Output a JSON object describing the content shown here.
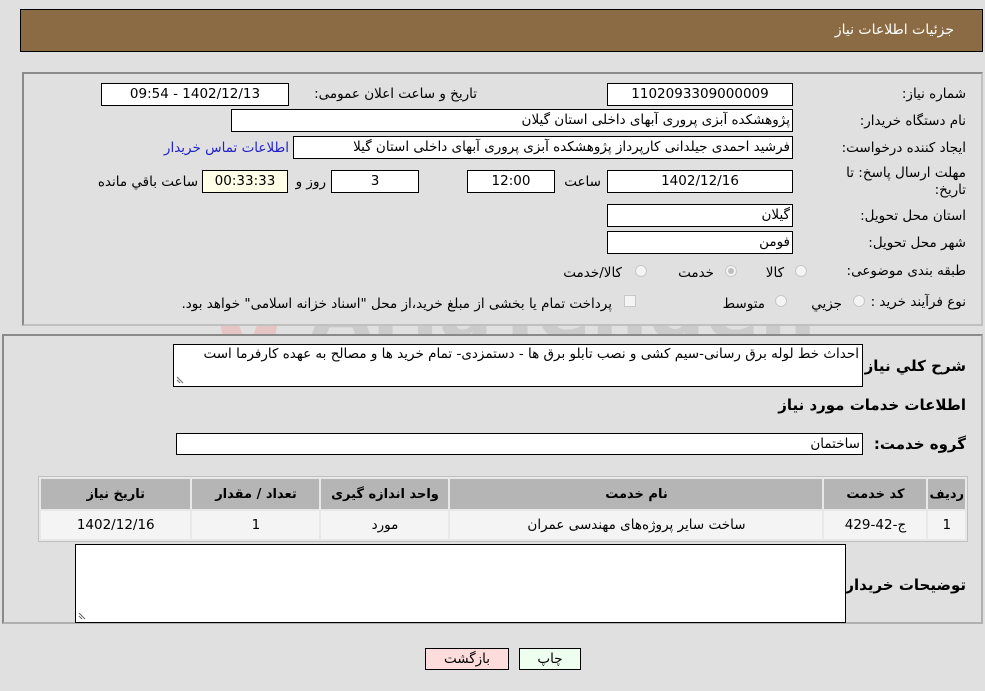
{
  "header": {
    "title": "جزئیات اطلاعات نیاز"
  },
  "form": {
    "need_number": {
      "label": "شماره نیاز:",
      "value": "1102093309000009"
    },
    "announce_datetime": {
      "label": "تاریخ و ساعت اعلان عمومی:",
      "value": "1402/12/13 - 09:54"
    },
    "buyer_org": {
      "label": "نام دستگاه خریدار:",
      "value": "پژوهشکده آبزی پروری آبهای داخلی استان گیلان"
    },
    "requester": {
      "label": "ایجاد کننده درخواست:",
      "value": "فرشید  احمدی جیلدانی کارپرداز پژوهشکده آبزی پروری آبهای داخلی استان گیلا"
    },
    "contact_link": "اطلاعات تماس خریدار",
    "deadline": {
      "label": "مهلت ارسال پاسخ: تا تاریخ:",
      "date": "1402/12/16",
      "time_label": "ساعت",
      "time": "12:00",
      "days": "3",
      "days_label": "روز و",
      "remaining": "00:33:33",
      "remaining_label": "ساعت باقي مانده"
    },
    "province": {
      "label": "استان محل تحویل:",
      "value": "گیلان"
    },
    "city": {
      "label": "شهر محل تحویل:",
      "value": "فومن"
    },
    "category": {
      "label": "طبقه بندی موضوعی:",
      "options": [
        "کالا",
        "خدمت",
        "کالا/خدمت"
      ],
      "selected": "خدمت"
    },
    "purchase_type": {
      "label": "نوع فرآیند خرید :",
      "options": [
        "جزيي",
        "متوسط"
      ],
      "selected": "",
      "treasury_note": "پرداخت تمام یا بخشی از مبلغ خرید،از محل \"اسناد خزانه اسلامی\" خواهد بود."
    }
  },
  "description": {
    "label": "شرح کلي نياز:",
    "value": "احداث خط لوله برق رسانی-سیم کشی و نصب تابلو برق ها - دستمزدی- تمام خرید ها و مصالح به عهده کارفرما است"
  },
  "services": {
    "section_title": "اطلاعات خدمات مورد نياز",
    "group_label": "گروه خدمت:",
    "group_value": "ساختمان",
    "table": {
      "headers": [
        "رديف",
        "کد خدمت",
        "نام خدمت",
        "واحد اندازه گيری",
        "تعداد / مقدار",
        "تاريخ نياز"
      ],
      "rows": [
        [
          "1",
          "ج-42-429",
          "ساخت سایر پروژه‌های مهندسی عمران",
          "مورد",
          "1",
          "1402/12/16"
        ]
      ]
    }
  },
  "buyer_notes": {
    "label": "توضيحات خريدار:",
    "value": ""
  },
  "buttons": {
    "print": "چاپ",
    "back": "بازگشت"
  },
  "watermark": "AriaTender.neT"
}
